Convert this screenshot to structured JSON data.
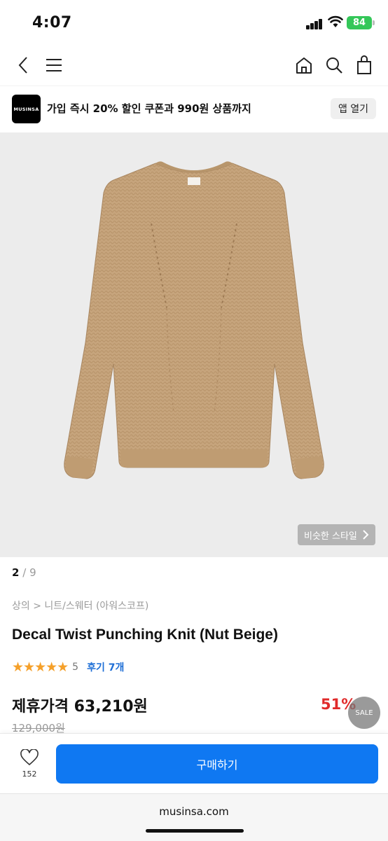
{
  "status_bar": {
    "time": "4:07",
    "battery": "84"
  },
  "nav": {
    "back_icon": "chevron-left-icon",
    "menu_icon": "hamburger-menu-icon",
    "home_icon": "home-icon",
    "search_icon": "search-icon",
    "bag_icon": "shopping-bag-icon"
  },
  "app_banner": {
    "logo_text": "MUSINSA",
    "promo": "가입 즉시 20% 할인 쿠폰과 990원 상품까지",
    "open_app": "앱 열기"
  },
  "gallery": {
    "current": "2",
    "separator": "/",
    "total": "9",
    "similar_style": "비슷한 스타일"
  },
  "product": {
    "breadcrumb": "상의 > 니트/스웨터 (아워스코프)",
    "title": "Decal Twist Punching Knit (Nut Beige)",
    "rating_stars": 5,
    "rating_score": "5",
    "review_count": "후기 7개",
    "price": "제휴가격 63,210원",
    "discount": "51%",
    "sale_badge": "SALE",
    "original_price": "129,000원",
    "accent_color": "#0f78f2",
    "discount_color": "#e02a2a",
    "star_color": "#f5a02a"
  },
  "purchase_bar": {
    "like_count": "152",
    "buy_label": "구매하기"
  },
  "browser": {
    "url": "musinsa.com"
  }
}
